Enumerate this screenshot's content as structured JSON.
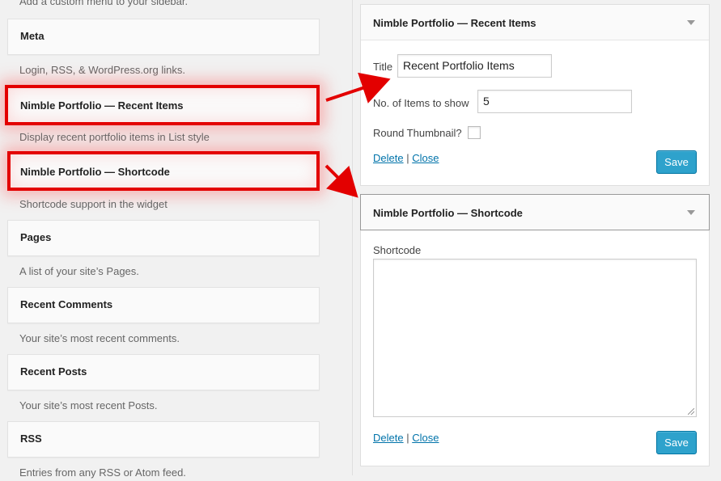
{
  "available_widgets": {
    "top_description": "Add a custom menu to your sidebar.",
    "items": [
      {
        "title": "Meta",
        "description": "Login, RSS, & WordPress.org links."
      },
      {
        "title": "Nimble Portfolio — Recent Items",
        "description": "Display recent portfolio items in List style"
      },
      {
        "title": "Nimble Portfolio — Shortcode",
        "description": "Shortcode support in the widget"
      },
      {
        "title": "Pages",
        "description": "A list of your site’s Pages."
      },
      {
        "title": "Recent Comments",
        "description": "Your site’s most recent comments."
      },
      {
        "title": "Recent Posts",
        "description": "Your site’s most recent Posts."
      },
      {
        "title": "RSS",
        "description": "Entries from any RSS or Atom feed."
      }
    ]
  },
  "sidebar_widgets": {
    "recent_items": {
      "title": "Nimble Portfolio — Recent Items",
      "title_label": "Title",
      "title_value": "Recent Portfolio Items",
      "count_label": "No. of Items to show",
      "count_value": "5",
      "thumb_label": "Round Thumbnail?",
      "thumb_checked": false,
      "delete_label": "Delete",
      "separator": "|",
      "close_label": "Close",
      "save_label": "Save"
    },
    "shortcode": {
      "title": "Nimble Portfolio — Shortcode",
      "shortcode_label": "Shortcode",
      "shortcode_value": "",
      "delete_label": "Delete",
      "separator": "|",
      "close_label": "Close",
      "save_label": "Save"
    }
  },
  "colors": {
    "highlight": "#e30000",
    "button": "#2ea2cc",
    "link": "#0073aa"
  }
}
